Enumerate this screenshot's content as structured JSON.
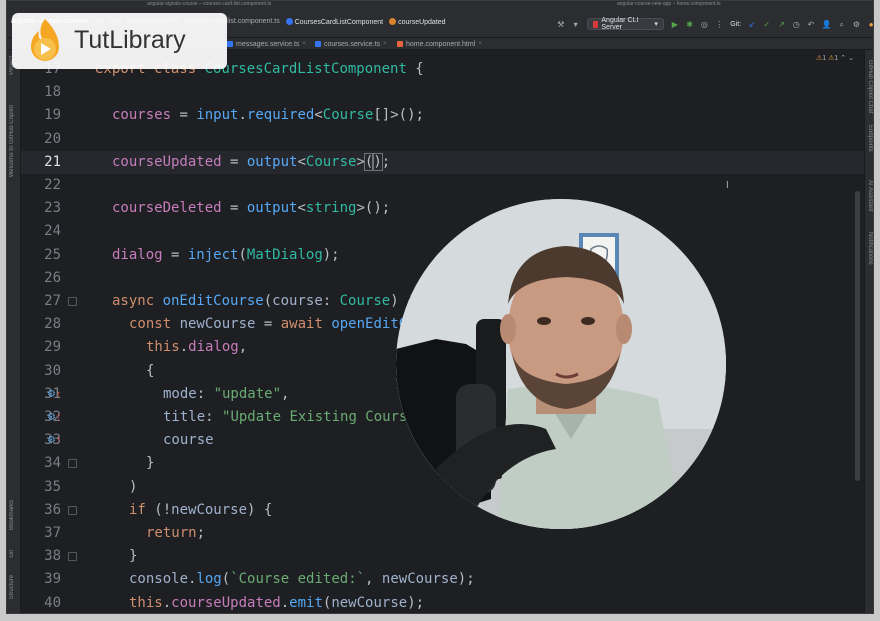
{
  "window": {
    "title": "angular-signals-course – courses-card-list.component.ts",
    "title_right": "angular-course-new-app – home.component.ts"
  },
  "breadcrumbs": {
    "project": "angular-signals-course",
    "items": [
      "src",
      "app",
      "courses-card-list"
    ],
    "file": "courses-card-list.component.ts",
    "class": "CoursesCardListComponent",
    "member": "courseUpdated"
  },
  "toolbar": {
    "run_config": "Angular CLI Server",
    "git_label": "Git:"
  },
  "tabs": [
    {
      "label": "messages.service.ts",
      "type": "ts"
    },
    {
      "label": "courses.service.ts",
      "type": "ts"
    },
    {
      "label": "home.component.html",
      "type": "html"
    }
  ],
  "inspections": {
    "warnings": "1",
    "weak_warnings": "1"
  },
  "left_tools": {
    "project": "Project",
    "copilot": "Welcome to GitHub Copilot",
    "bookmarks": "Bookmarks",
    "git": "Git",
    "structure": "Structure"
  },
  "right_tools": {
    "copilot_chat": "GitHub Copilot Chat",
    "endpoints": "Endpoints",
    "ai_assistant": "AI Assistant",
    "notifications": "Notifications"
  },
  "editor": {
    "current_line": 21,
    "lines": [
      {
        "n": "17",
        "indent": 0,
        "tokens": [
          [
            "kw",
            "export class "
          ],
          [
            "ty",
            "CoursesCardListComponent"
          ],
          [
            "p",
            " {"
          ]
        ]
      },
      {
        "n": "18",
        "indent": 0,
        "tokens": []
      },
      {
        "n": "19",
        "indent": 1,
        "tokens": [
          [
            "fld",
            "courses"
          ],
          [
            "p",
            " = "
          ],
          [
            "fn",
            "input"
          ],
          [
            "p",
            "."
          ],
          [
            "fn",
            "required"
          ],
          [
            "p",
            "<"
          ],
          [
            "ty",
            "Course"
          ],
          [
            "p",
            "[]>();"
          ]
        ]
      },
      {
        "n": "20",
        "indent": 0,
        "tokens": []
      },
      {
        "n": "21",
        "indent": 1,
        "tokens": [
          [
            "fld",
            "courseUpdated"
          ],
          [
            "p",
            " = "
          ],
          [
            "fn",
            "output"
          ],
          [
            "p",
            "<"
          ],
          [
            "ty",
            "Course"
          ],
          [
            "p",
            ">"
          ],
          [
            "br",
            "("
          ],
          [
            "br",
            ")"
          ],
          [
            "p",
            ";"
          ]
        ]
      },
      {
        "n": "22",
        "indent": 0,
        "tokens": []
      },
      {
        "n": "23",
        "indent": 1,
        "tokens": [
          [
            "fld",
            "courseDeleted"
          ],
          [
            "p",
            " = "
          ],
          [
            "fn",
            "output"
          ],
          [
            "p",
            "<"
          ],
          [
            "ty",
            "string"
          ],
          [
            "p",
            ">();"
          ]
        ]
      },
      {
        "n": "24",
        "indent": 0,
        "tokens": []
      },
      {
        "n": "25",
        "indent": 1,
        "tokens": [
          [
            "fld",
            "dialog"
          ],
          [
            "p",
            " = "
          ],
          [
            "fn",
            "inject"
          ],
          [
            "p",
            "("
          ],
          [
            "ty",
            "MatDialog"
          ],
          [
            "p",
            ");"
          ]
        ]
      },
      {
        "n": "26",
        "indent": 0,
        "tokens": []
      },
      {
        "n": "27",
        "indent": 1,
        "tokens": [
          [
            "kw",
            "async "
          ],
          [
            "fn",
            "onEditCourse"
          ],
          [
            "p",
            "("
          ],
          [
            "pf",
            "course"
          ],
          [
            "p",
            ": "
          ],
          [
            "ty",
            "Course"
          ],
          [
            "p",
            ") {"
          ]
        ]
      },
      {
        "n": "28",
        "indent": 2,
        "tokens": [
          [
            "kw",
            "const "
          ],
          [
            "pf",
            "newCourse"
          ],
          [
            "p",
            " = "
          ],
          [
            "kw",
            "await "
          ],
          [
            "fn",
            "openEditCourseDialog"
          ],
          [
            "p",
            "("
          ]
        ]
      },
      {
        "n": "29",
        "indent": 3,
        "tokens": [
          [
            "kw",
            "this"
          ],
          [
            "p",
            "."
          ],
          [
            "fld",
            "dialog"
          ],
          [
            "p",
            ","
          ]
        ]
      },
      {
        "n": "30",
        "indent": 3,
        "tokens": [
          [
            "p",
            "{"
          ]
        ]
      },
      {
        "n": "31",
        "indent": 4,
        "tokens": [
          [
            "pf",
            "mode"
          ],
          [
            "p",
            ": "
          ],
          [
            "str",
            "\"update\""
          ],
          [
            "p",
            ","
          ]
        ]
      },
      {
        "n": "32",
        "indent": 4,
        "tokens": [
          [
            "pf",
            "title"
          ],
          [
            "p",
            ": "
          ],
          [
            "str",
            "\"Update Existing Course\""
          ]
        ]
      },
      {
        "n": "33",
        "indent": 4,
        "tokens": [
          [
            "pf",
            "course"
          ]
        ]
      },
      {
        "n": "34",
        "indent": 3,
        "tokens": [
          [
            "p",
            "}"
          ]
        ]
      },
      {
        "n": "35",
        "indent": 2,
        "tokens": [
          [
            "p",
            ")"
          ]
        ]
      },
      {
        "n": "36",
        "indent": 2,
        "tokens": [
          [
            "kw",
            "if "
          ],
          [
            "p",
            "(!"
          ],
          [
            "pf",
            "newCourse"
          ],
          [
            "p",
            ") {"
          ]
        ]
      },
      {
        "n": "37",
        "indent": 3,
        "tokens": [
          [
            "kw",
            "return"
          ],
          [
            "p",
            ";"
          ]
        ]
      },
      {
        "n": "38",
        "indent": 2,
        "tokens": [
          [
            "p",
            "}"
          ]
        ]
      },
      {
        "n": "39",
        "indent": 2,
        "tokens": [
          [
            "pf",
            "console"
          ],
          [
            "p",
            "."
          ],
          [
            "fn",
            "log"
          ],
          [
            "p",
            "("
          ],
          [
            "str",
            "`Course edited:`"
          ],
          [
            "p",
            ", "
          ],
          [
            "pf",
            "newCourse"
          ],
          [
            "p",
            ");"
          ]
        ]
      },
      {
        "n": "40",
        "indent": 2,
        "tokens": [
          [
            "kw",
            "this"
          ],
          [
            "p",
            "."
          ],
          [
            "fld",
            "courseUpdated"
          ],
          [
            "p",
            "."
          ],
          [
            "fn",
            "emit"
          ],
          [
            "p",
            "("
          ],
          [
            "pf",
            "newCourse"
          ],
          [
            "p",
            ");"
          ]
        ]
      }
    ]
  },
  "watermark": {
    "text": "TutLibrary"
  },
  "colors": {
    "editor_bg": "#1e1f22",
    "keyword": "#cf8e6d",
    "field": "#c77dbb",
    "function": "#56a8f5",
    "type": "#2fbaa3",
    "string": "#6aab73",
    "accent": "#3574f0"
  }
}
